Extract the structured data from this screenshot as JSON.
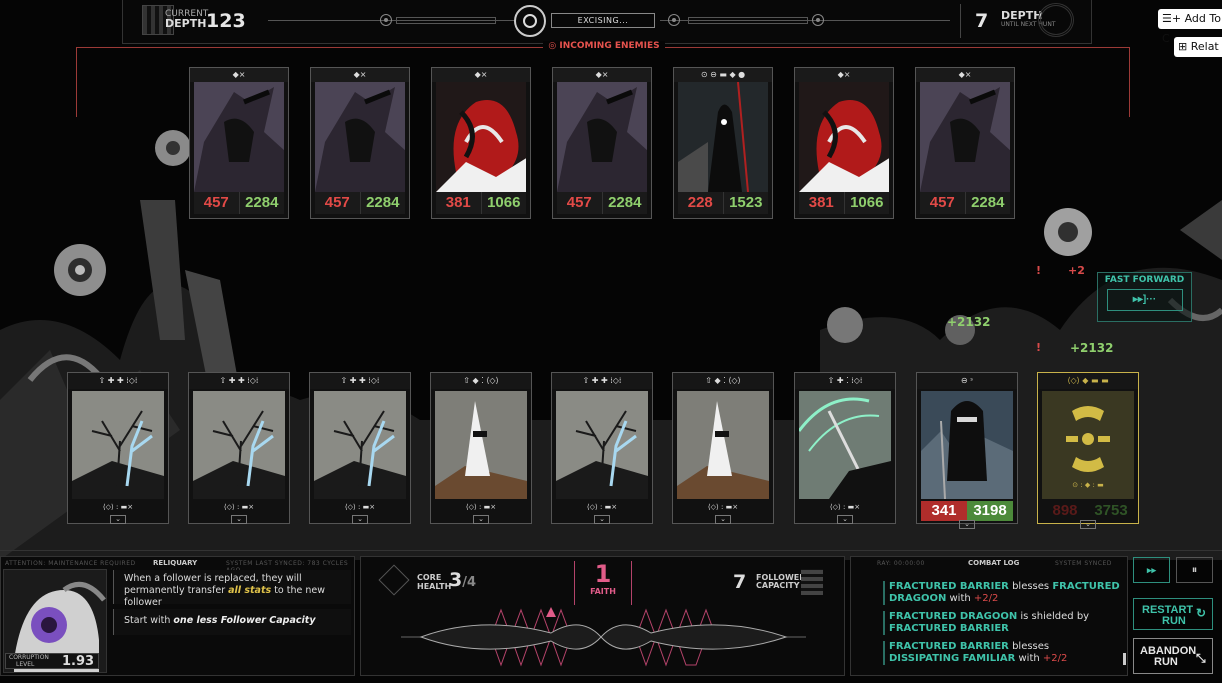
{
  "top_bar": {
    "current_label_1": "CURRENT",
    "current_label_2": "DEPTH",
    "current_depth": "123",
    "status": "EXCISING...",
    "until_value": "7",
    "until_label_1": "DEPTH",
    "until_label_2": "UNTIL NEXT HUNT"
  },
  "incoming_label": "INCOMING ENEMIES",
  "enemies": [
    {
      "icons": "◆×",
      "atk": "457",
      "hp": "2284",
      "art": "gray"
    },
    {
      "icons": "◆×",
      "atk": "457",
      "hp": "2284",
      "art": "gray"
    },
    {
      "icons": "◆×",
      "atk": "381",
      "hp": "1066",
      "art": "red"
    },
    {
      "icons": "◆×",
      "atk": "457",
      "hp": "2284",
      "art": "gray"
    },
    {
      "icons": "⊙ ⊖ ▬ ◆ ●",
      "atk": "228",
      "hp": "1523",
      "art": "dark"
    },
    {
      "icons": "◆×",
      "atk": "381",
      "hp": "1066",
      "art": "red"
    },
    {
      "icons": "◆×",
      "atk": "457",
      "hp": "2284",
      "art": "gray"
    }
  ],
  "followers": [
    {
      "icons": "⇧ ✚ ✚ ⁞◇⁞",
      "bottom": "⟨◇⟩ : ▬×",
      "art": "tree"
    },
    {
      "icons": "⇧ ✚ ✚ ⁞◇⁞",
      "bottom": "⟨◇⟩ : ▬×",
      "art": "tree"
    },
    {
      "icons": "⇧ ✚ ✚ ⁞◇⁞",
      "bottom": "⟨◇⟩ : ▬×",
      "art": "tree"
    },
    {
      "icons": "⇧ ◆ ⁚ ⟨◇⟩",
      "bottom": "⟨◇⟩ : ▬×",
      "art": "spike"
    },
    {
      "icons": "⇧ ✚ ✚ ⁞◇⁞",
      "bottom": "⟨◇⟩ : ▬×",
      "art": "tree"
    },
    {
      "icons": "⇧ ◆ ⁚ ⟨◇⟩",
      "bottom": "⟨◇⟩ : ▬×",
      "art": "spike"
    },
    {
      "icons": "⇧ ✚ ⁚ ⁞◇⁞",
      "bottom": "⟨◇⟩ : ▬×",
      "art": "scythe"
    }
  ],
  "knight": {
    "icons": "⊖ ˢ",
    "atk": "341",
    "hp": "3198"
  },
  "selected": {
    "icons": "⟨◇⟩ ◆ ▬ ▬",
    "bottom": "⊙ : ◆ : ▬",
    "atk": "898",
    "hp": "3753"
  },
  "fast_forward": {
    "label": "FAST FORWARD",
    "icon": "▸▸]···"
  },
  "floaters": {
    "a": "+2132",
    "b": "+2132",
    "c": "+2",
    "d": "!",
    "e": "!"
  },
  "reliquary": {
    "header_left": "ATTENTION: MAINTENANCE REQUIRED",
    "title": "RELIQUARY",
    "header_right": "SYSTEM LAST SYNCED: 783 CYCLES AGO",
    "text1_a": "When a follower is replaced, they will permanently transfer ",
    "text1_b": "all stats",
    "text1_c": " to the new follower",
    "text2_a": "Start with ",
    "text2_b": "one less Follower Capacity",
    "corruption_label_1": "CORRUPTION",
    "corruption_label_2": "LEVEL",
    "corruption_value": "1.93"
  },
  "core": {
    "label_1": "CORE",
    "label_2": "HEALTH",
    "value": "3",
    "max": "/4",
    "faith_value": "1",
    "faith_label": "FAITH",
    "capacity_value": "7",
    "capacity_label_1": "FOLLOWER",
    "capacity_label_2": "CAPACITY"
  },
  "combat_log": {
    "title": "COMBAT LOG",
    "header_left": "RAY: 00:00:00",
    "header_right": "SYSTEM SYNCED",
    "entries": [
      {
        "a": "FRACTURED BARRIER",
        "b": " blesses ",
        "c": "FRACTURED DRAGOON",
        "d": " with ",
        "e": "+2/2"
      },
      {
        "a": "FRACTURED DRAGOON",
        "b": " is shielded by ",
        "c": "FRACTURED BARRIER",
        "d": "",
        "e": ""
      },
      {
        "a": "FRACTURED BARRIER",
        "b": " blesses ",
        "c": "DISSIPATING FAMILIAR",
        "d": " with ",
        "e": "+2/2"
      }
    ]
  },
  "buttons": {
    "restart_1": "RESTART",
    "restart_2": "RUN",
    "abandon_1": "ABANDON",
    "abandon_2": "RUN"
  },
  "browser": {
    "add_to": "Add To C",
    "related": "Relat"
  },
  "colors": {
    "accent": "#3fc3aa",
    "danger": "#e24a47",
    "health": "#8fcf6d",
    "gold": "#c8b24a"
  }
}
